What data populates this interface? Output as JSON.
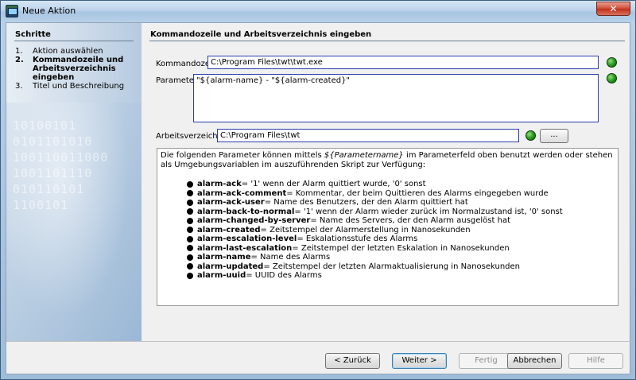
{
  "window": {
    "title": "Neue Aktion",
    "close_label": "✕"
  },
  "sidebar": {
    "title": "Schritte",
    "steps": [
      {
        "num": "1.",
        "label": "Aktion auswählen"
      },
      {
        "num": "2.",
        "label": "Kommandozeile und Arbeitsverzeichnis eingeben"
      },
      {
        "num": "3.",
        "label": "Titel und Beschreibung"
      }
    ],
    "binary_rows": [
      "10100101",
      "0101101010",
      "100110011000",
      "1001101110",
      "010110101",
      "1100101"
    ]
  },
  "main": {
    "title": "Kommandozeile und Arbeitsverzeichnis eingeben",
    "command_label": "Kommandozeile",
    "command_value": "C:\\Program Files\\twt\\twt.exe",
    "parameter_label": "Parameter",
    "parameter_value": "\"${alarm-name} - \"${alarm-created}\"",
    "workdir_label": "Arbeitsverzeichnis",
    "workdir_value": "C:\\Program Files\\twt",
    "browse_label": "...",
    "info_intro_1": "Die folgenden Parameter können mittels ",
    "info_var": "${Parametername}",
    "info_intro_2": " im Parameterfeld oben benutzt werden oder stehen als Umgebungsvariablen im auszuführenden Skript zur Verfügung:",
    "params": [
      {
        "name": "alarm-ack",
        "desc": " = '1' wenn der Alarm quittiert wurde, '0' sonst"
      },
      {
        "name": "alarm-ack-comment",
        "desc": " = Kommentar, der beim Quittieren des Alarms eingegeben wurde"
      },
      {
        "name": "alarm-ack-user",
        "desc": " = Name des Benutzers, der den Alarm quittiert hat"
      },
      {
        "name": "alarm-back-to-normal",
        "desc": " = '1' wenn der Alarm wieder zurück im Normalzustand ist, '0' sonst"
      },
      {
        "name": "alarm-changed-by-server",
        "desc": " = Name des Servers, der den Alarm ausgelöst hat"
      },
      {
        "name": "alarm-created",
        "desc": " = Zeitstempel der Alarmerstellung in Nanosekunden"
      },
      {
        "name": "alarm-escalation-level",
        "desc": " = Eskalationsstufe des Alarms"
      },
      {
        "name": "alarm-last-escalation",
        "desc": " = Zeitstempel der letzten Eskalation in Nanosekunden"
      },
      {
        "name": "alarm-name",
        "desc": " = Name des Alarms"
      },
      {
        "name": "alarm-updated",
        "desc": " = Zeitstempel der letzten Alarmaktualisierung in Nanosekunden"
      },
      {
        "name": "alarm-uuid",
        "desc": " = UUID des Alarms"
      }
    ],
    "status_color": "#2a9a20"
  },
  "footer": {
    "back_label": "< Zurück",
    "next_label": "Weiter >",
    "finish_label": "Fertig",
    "cancel_label": "Abbrechen",
    "help_label": "Hilfe"
  }
}
